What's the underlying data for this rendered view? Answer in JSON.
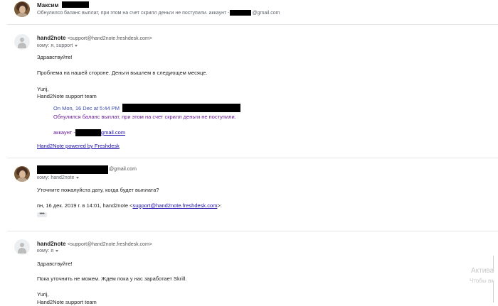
{
  "collapsed": {
    "sender": "Максим",
    "snippet_prefix": "Обнулился баланс выплат, при этом на счет скрилл деньги не поступили. аккаунт -",
    "snippet_suffix": "@gmail.com"
  },
  "msg1": {
    "sender": "hand2note",
    "email": "<support@hand2note.freshdesk.com>",
    "to": "кому: я, support",
    "greeting": "Здравствуйте!",
    "line1": "Проблема на нашей стороне. Деньги вышлем в следующем месяце.",
    "sig1": "Yurij,",
    "sig2": "Hand2Note support team",
    "quote_header": "On Mon, 16 Dec at 5:44 PM",
    "quote_line1": "Обнулился баланс выплат, при этом на счет скрилл деньги не поступили.",
    "quote_account_prefix": "аккаунт -",
    "quote_account_suffix": "gmail.com",
    "footer_link": "Hand2Note powered by Freshdesk"
  },
  "msg2": {
    "email_suffix": "@gmail.com",
    "to": "кому: hand2note",
    "line1": "Уточните пожалуйста дату, когда будет выплата?",
    "quote_prefix": "пн, 16 дек. 2019 г. в 14:01, hand2note <",
    "quote_link": "support@hand2note.freshdesk.com",
    "quote_suffix": ">:",
    "dots": "•••"
  },
  "msg3": {
    "sender": "hand2note",
    "email": "<support@hand2note.freshdesk.com>",
    "to": "кому: я",
    "greeting": "Здравствуйте!",
    "line1": "Пока уточнить не можем. Ждем пока у нас заработает Skrill.",
    "sig1": "Yurij,",
    "sig2": "Hand2Note support team"
  },
  "watermark": {
    "line1": "Актива",
    "line2": "Чтобы ак"
  }
}
